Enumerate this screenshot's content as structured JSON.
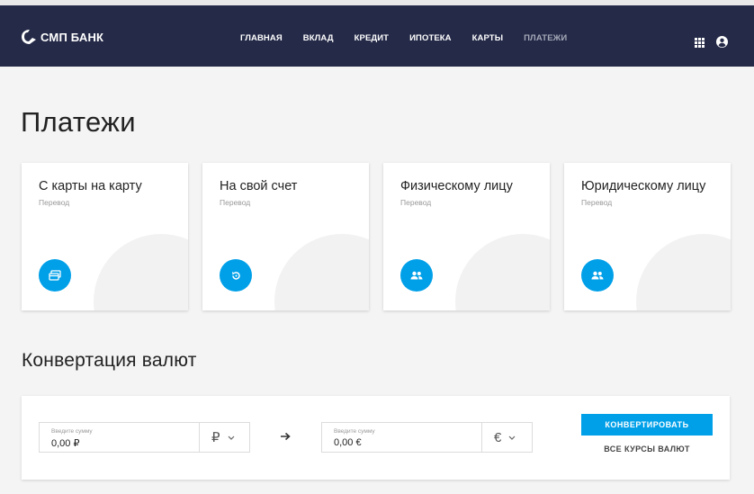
{
  "header": {
    "brand": "СМП БАНК",
    "nav": [
      {
        "label": "ГЛАВНАЯ",
        "active": false
      },
      {
        "label": "ВКЛАД",
        "active": false
      },
      {
        "label": "КРЕДИТ",
        "active": false
      },
      {
        "label": "ИПОТЕКА",
        "active": false
      },
      {
        "label": "КАРТЫ",
        "active": false
      },
      {
        "label": "ПЛАТЕЖИ",
        "active": true
      }
    ],
    "icons": [
      "apps-grid-icon",
      "user-account-icon"
    ],
    "colors": {
      "background": "#252a48",
      "text": "#ffffff",
      "active_text": "#a6a9b8"
    }
  },
  "page_title": "Платежи",
  "cards": [
    {
      "title": "С карты на карту",
      "subtitle": "Перевод",
      "icon": "card-transfer-icon"
    },
    {
      "title": "На свой счет",
      "subtitle": "Перевод",
      "icon": "refresh-icon"
    },
    {
      "title": "Физическому лицу",
      "subtitle": "Перевод",
      "icon": "people-icon"
    },
    {
      "title": "Юридическому лицу",
      "subtitle": "Перевод",
      "icon": "people-icon"
    }
  ],
  "conversion": {
    "title": "Конвертация валют",
    "from": {
      "label": "Введите сумму",
      "value": "0,00 ₽",
      "currency": "₽"
    },
    "to": {
      "label": "Введите сумму",
      "value": "0,00 €",
      "currency": "€"
    },
    "convert_label": "КОНВЕРТИРОВАТЬ",
    "rates_label": "ВСЕ КУРСЫ ВАЛЮТ"
  },
  "colors": {
    "accent": "#00a0e9",
    "page_background": "#f4f4f4"
  }
}
